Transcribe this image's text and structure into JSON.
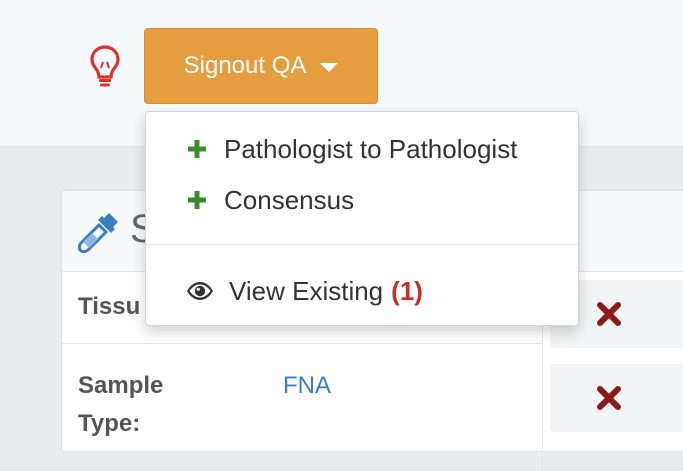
{
  "signout": {
    "button_label": "Signout QA",
    "menu": {
      "items": [
        {
          "label": "Pathologist to Pathologist",
          "icon": "plus-icon"
        },
        {
          "label": "Consensus",
          "icon": "plus-icon"
        }
      ],
      "view_existing": {
        "label": "View Existing",
        "count": "(1)",
        "icon": "eye-icon"
      }
    }
  },
  "panel": {
    "title": "S",
    "icon": "eyedropper-icon",
    "fields": [
      {
        "label": "Tissu",
        "value": ""
      },
      {
        "label": "Sample Type:",
        "value": "FNA"
      }
    ]
  },
  "colors": {
    "button": "#e49e3f",
    "plus": "#3c8c2c",
    "count": "#c9302c",
    "remove": "#8b1a1a",
    "bulb": "#d9342b",
    "link": "#3a7dc0"
  }
}
